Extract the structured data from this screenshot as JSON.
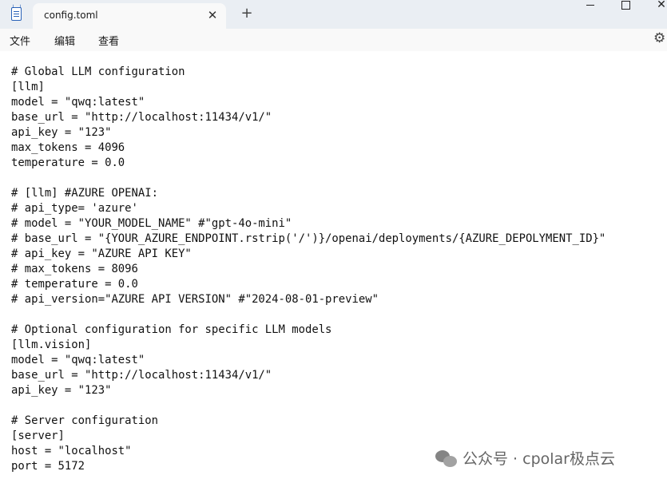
{
  "tab": {
    "title": "config.toml",
    "close_glyph": "✕"
  },
  "new_tab_glyph": "+",
  "window": {
    "close_glyph": "✕"
  },
  "menu": [
    "文件",
    "编辑",
    "查看"
  ],
  "editor": {
    "lines": [
      "# Global LLM configuration",
      "[llm]",
      "model = \"qwq:latest\"",
      "base_url = \"http://localhost:11434/v1/\"",
      "api_key = \"123\"",
      "max_tokens = 4096",
      "temperature = 0.0",
      "",
      "# [llm] #AZURE OPENAI:",
      "# api_type= 'azure'",
      "# model = \"YOUR_MODEL_NAME\" #\"gpt-4o-mini\"",
      "# base_url = \"{YOUR_AZURE_ENDPOINT.rstrip('/')}/openai/deployments/{AZURE_DEPOLYMENT_ID}\"",
      "# api_key = \"AZURE API KEY\"",
      "# max_tokens = 8096",
      "# temperature = 0.0",
      "# api_version=\"AZURE API VERSION\" #\"2024-08-01-preview\"",
      "",
      "# Optional configuration for specific LLM models",
      "[llm.vision]",
      "model = \"qwq:latest\"",
      "base_url = \"http://localhost:11434/v1/\"",
      "api_key = \"123\"",
      "",
      "# Server configuration",
      "[server]",
      "host = \"localhost\"",
      "port = 5172"
    ]
  },
  "watermark": {
    "text": "公众号 · cpolar极点云"
  },
  "icons": {
    "app": "notepad-icon",
    "settings": "gear-icon",
    "watermark": "wechat-logo-icon"
  }
}
